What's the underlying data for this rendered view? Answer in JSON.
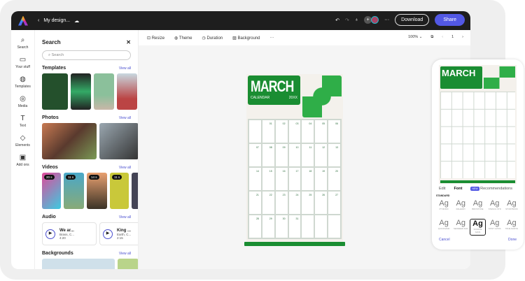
{
  "header": {
    "title": "My design...",
    "download": "Download",
    "share": "Share"
  },
  "rail": [
    {
      "icon": "⌕",
      "label": "Search"
    },
    {
      "icon": "▭",
      "label": "Your stuff"
    },
    {
      "icon": "◍",
      "label": "Templates"
    },
    {
      "icon": "◎",
      "label": "Media"
    },
    {
      "icon": "T",
      "label": "Text"
    },
    {
      "icon": "◇",
      "label": "Elements"
    },
    {
      "icon": "▣",
      "label": "Add ons"
    }
  ],
  "panel": {
    "title": "Search",
    "close": "✕",
    "search_placeholder": "Search",
    "view_all": "View all",
    "sections": {
      "templates": "Templates",
      "photos": "Photos",
      "videos": "Videos",
      "audio": "Audio",
      "backgrounds": "Backgrounds"
    },
    "videos": [
      "20 s",
      "11 s",
      "14 s",
      "11 s"
    ],
    "audio": [
      {
        "title": "We ar...",
        "artist": "Brass, C...",
        "duration": "4:20"
      },
      {
        "title": "King ...",
        "artist": "Earth, C...",
        "duration": "2:15"
      }
    ]
  },
  "toolbar": {
    "resize": "Resize",
    "theme": "Theme",
    "duration": "Duration",
    "background": "Background",
    "more": "···",
    "zoom": "100%",
    "page": "1"
  },
  "calendar": {
    "month": "MARCH",
    "sub": "CALENDAR",
    "year": "20XX",
    "days": [
      "",
      "01",
      "02",
      "03",
      "04",
      "05",
      "06",
      "07",
      "08",
      "09",
      "10",
      "11",
      "12",
      "13",
      "14",
      "15",
      "16",
      "17",
      "18",
      "19",
      "20",
      "21",
      "22",
      "23",
      "24",
      "25",
      "26",
      "27",
      "28",
      "29",
      "30",
      "31",
      "",
      "",
      ""
    ]
  },
  "phone": {
    "tabs": {
      "edit": "Edit",
      "font": "Font",
      "new": "NEW",
      "recommendations": "Recommendations"
    },
    "standard": "STANDARD",
    "fonts": [
      "PT MONO",
      "RALEWAY",
      "BRIXSTONE",
      "STENCIL STD",
      "STORYBOOK",
      "QUICKSAND",
      "SEAWEED SCR",
      "SOURCE SANS",
      "STINT ULTRA",
      "TRUE NORTH"
    ],
    "sample": "Ag",
    "cancel": "Cancel",
    "done": "Done"
  }
}
